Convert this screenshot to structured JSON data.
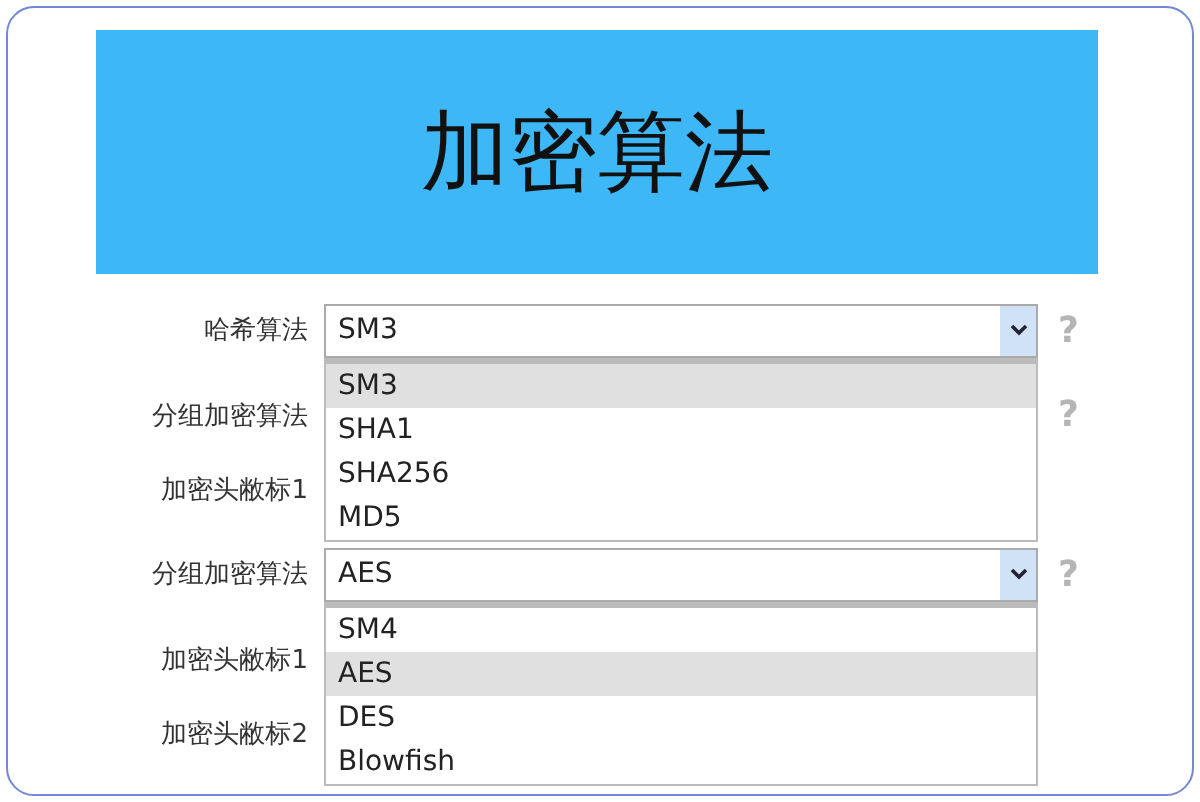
{
  "banner": {
    "title": "加密算法"
  },
  "rows": [
    {
      "label": "哈希算法",
      "kind": "select",
      "value": "SM3",
      "help": "?",
      "options": [
        {
          "label": "SM3",
          "selected": true
        },
        {
          "label": "SHA1",
          "selected": false
        },
        {
          "label": "SHA256",
          "selected": false
        },
        {
          "label": "MD5",
          "selected": false
        }
      ]
    },
    {
      "label": "分组加密算法",
      "kind": "hidden",
      "help": "?"
    },
    {
      "label": "加密头敝标1",
      "kind": "hidden"
    },
    {
      "label": "分组加密算法",
      "kind": "select",
      "value": "AES",
      "help": "?",
      "options": [
        {
          "label": "SM4",
          "selected": false
        },
        {
          "label": "AES",
          "selected": true
        },
        {
          "label": "DES",
          "selected": false
        },
        {
          "label": "Blowfish",
          "selected": false
        }
      ]
    },
    {
      "label": "加密头敝标1",
      "kind": "hidden"
    },
    {
      "label": "加密头敝标2",
      "kind": "hidden"
    }
  ]
}
